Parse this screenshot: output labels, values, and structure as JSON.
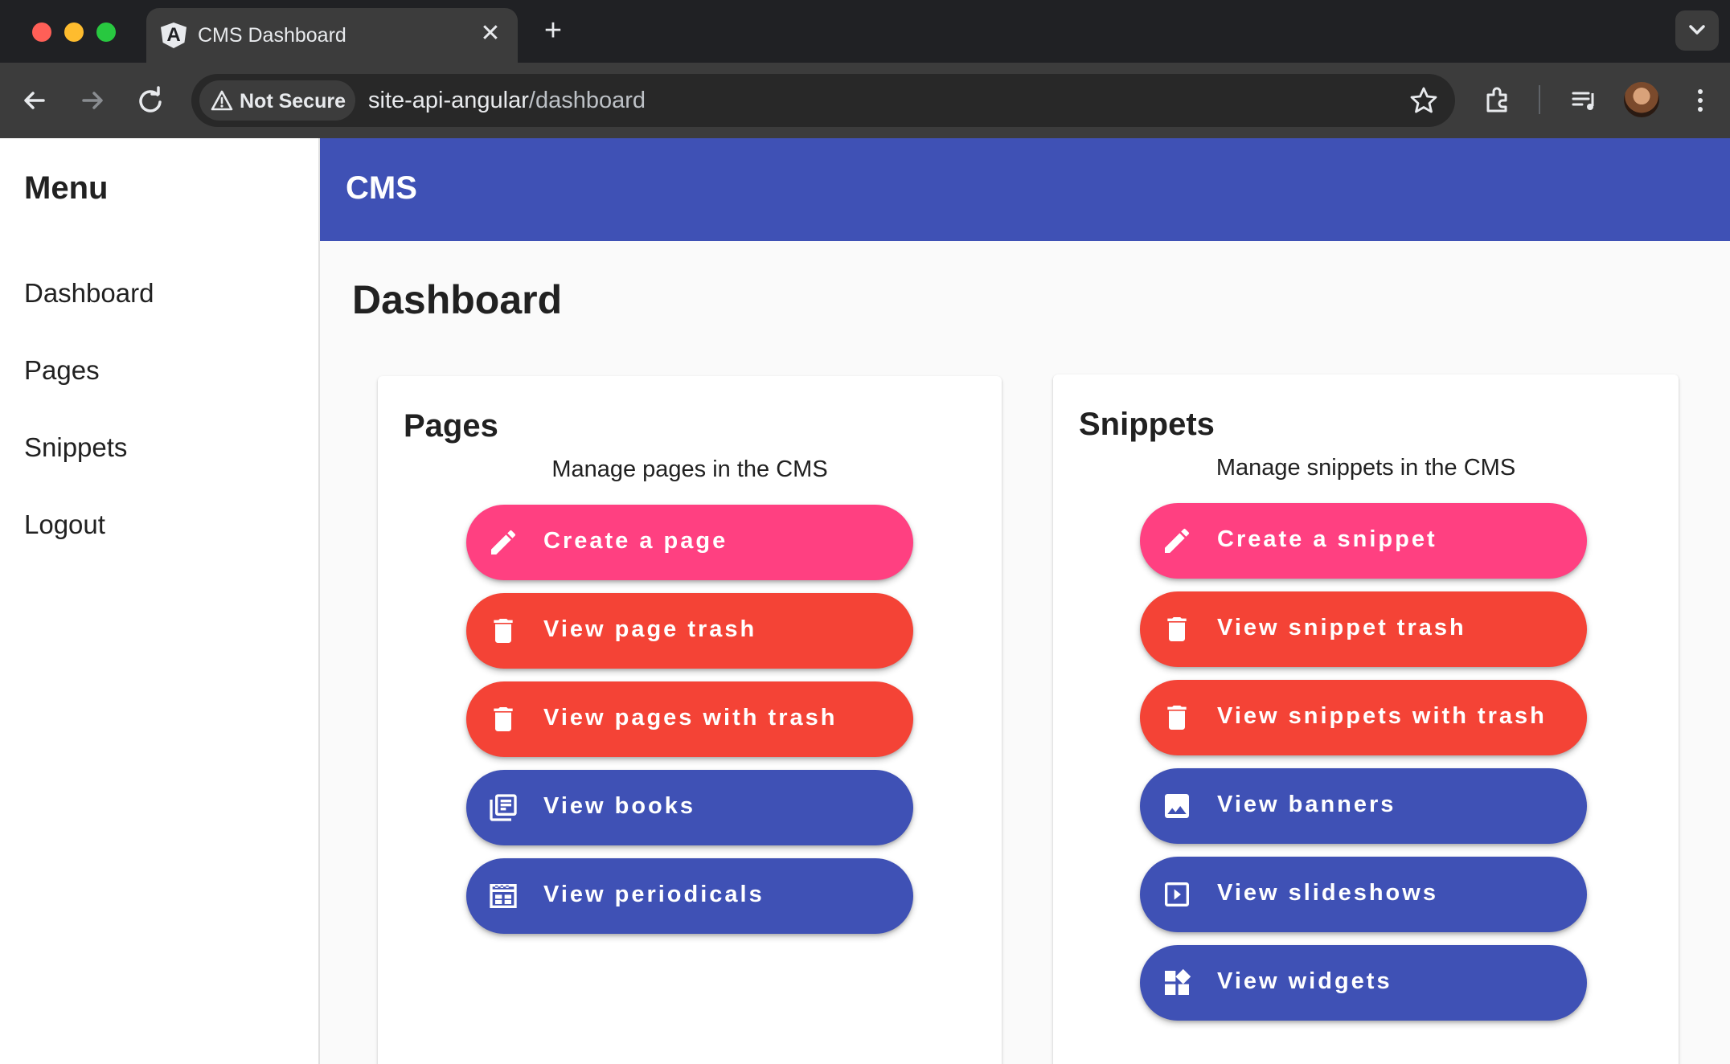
{
  "browser": {
    "tab_title": "CMS Dashboard",
    "security_label": "Not Secure",
    "url_host": "site-api-angular",
    "url_path": "/dashboard"
  },
  "sidebar": {
    "title": "Menu",
    "items": [
      {
        "label": "Dashboard"
      },
      {
        "label": "Pages"
      },
      {
        "label": "Snippets"
      },
      {
        "label": "Logout"
      }
    ]
  },
  "header": {
    "brand": "CMS"
  },
  "main": {
    "heading": "Dashboard",
    "pages_card": {
      "title": "Pages",
      "subtitle": "Manage pages in the CMS",
      "buttons": [
        {
          "label": "Create a page",
          "icon": "pencil-icon",
          "color": "#ff4081"
        },
        {
          "label": "View page trash",
          "icon": "trash-icon",
          "color": "#f44336"
        },
        {
          "label": "View pages with trash",
          "icon": "trash-icon",
          "color": "#f44336"
        },
        {
          "label": "View books",
          "icon": "library-books-icon",
          "color": "#3f51b5"
        },
        {
          "label": "View periodicals",
          "icon": "calendar-view-icon",
          "color": "#3f51b5"
        }
      ]
    },
    "snippets_card": {
      "title": "Snippets",
      "subtitle": "Manage snippets in the CMS",
      "buttons": [
        {
          "label": "Create a snippet",
          "icon": "pencil-icon",
          "color": "#ff4081"
        },
        {
          "label": "View snippet trash",
          "icon": "trash-icon",
          "color": "#f44336"
        },
        {
          "label": "View snippets with trash",
          "icon": "trash-icon",
          "color": "#f44336"
        },
        {
          "label": "View banners",
          "icon": "image-icon",
          "color": "#3f51b5"
        },
        {
          "label": "View slideshows",
          "icon": "slideshow-icon",
          "color": "#3f51b5"
        },
        {
          "label": "View widgets",
          "icon": "widgets-icon",
          "color": "#3f51b5"
        }
      ]
    }
  },
  "colors": {
    "primary": "#3f51b5",
    "accent": "#ff4081",
    "warn": "#f44336"
  }
}
